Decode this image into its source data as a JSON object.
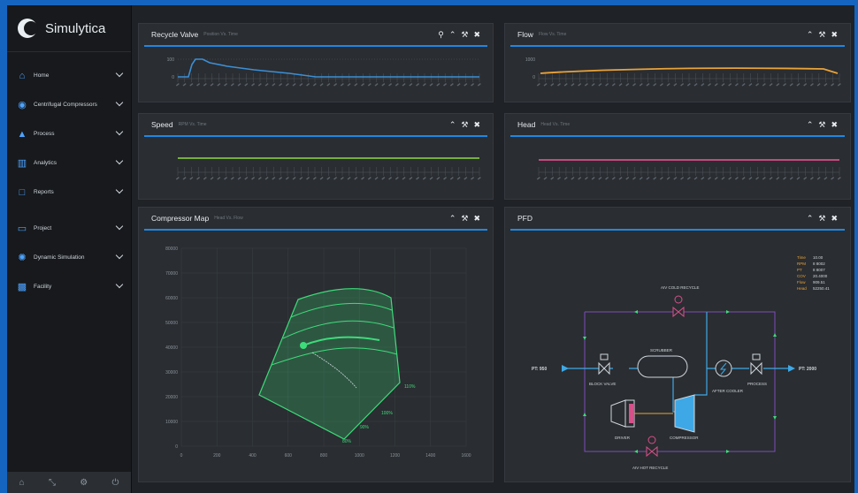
{
  "app": {
    "name": "Simulytica"
  },
  "sidebar": {
    "items": [
      {
        "label": "Home",
        "icon": "home-icon"
      },
      {
        "label": "Centrifugal Compressors",
        "icon": "compressor-icon"
      },
      {
        "label": "Process",
        "icon": "flask-icon"
      },
      {
        "label": "Analytics",
        "icon": "bar-chart-icon"
      },
      {
        "label": "Reports",
        "icon": "report-icon"
      },
      {
        "label": "Project",
        "icon": "folder-icon"
      },
      {
        "label": "Dynamic Simulation",
        "icon": "simulation-icon"
      },
      {
        "label": "Facility",
        "icon": "factory-icon"
      }
    ],
    "footer": [
      "home-icon",
      "expand-icon",
      "settings-icon",
      "power-icon"
    ]
  },
  "panels": {
    "recycle": {
      "title": "Recycle Valve",
      "subtitle": "Position Vs. Time",
      "ytick_hi": "100",
      "ytick_lo": "0",
      "color": "#3b8fd6"
    },
    "flow": {
      "title": "Flow",
      "subtitle": "Flow Vs. Time",
      "ytick_hi": "1000",
      "ytick_lo": "0",
      "color": "#e8a33a"
    },
    "speed": {
      "title": "Speed",
      "subtitle": "RPM Vs. Time",
      "color": "#7fc241"
    },
    "head": {
      "title": "Head",
      "subtitle": "Head Vs. Time",
      "color": "#d94f8a"
    },
    "map": {
      "title": "Compressor Map",
      "subtitle": "Head Vs. Flow"
    },
    "pfd": {
      "title": "PFD"
    }
  },
  "chart_data": {
    "type": "line",
    "title": "Compressor Map",
    "subtitle": "Head Vs. Flow",
    "x_ticks": [
      "0",
      "200",
      "400",
      "600",
      "800",
      "1000",
      "1200",
      "1400",
      "1600"
    ],
    "y_ticks": [
      "80000",
      "70000",
      "60000",
      "50000",
      "40000",
      "30000",
      "20000",
      "10000",
      "0"
    ],
    "xlim": [
      0,
      1600
    ],
    "ylim": [
      0,
      80000
    ],
    "grid": true,
    "speed_labels": [
      "80%",
      "90%",
      "100%",
      "110%"
    ]
  },
  "pfd": {
    "pt_in": "PT: 950",
    "pt_out": "PT: 2000",
    "block_valve": "BLOCK VALVE",
    "scrubber": "SCRUBBER",
    "after_cooler": "AFTER COOLER",
    "process": "PROCESS",
    "driver": "DRIVER",
    "compressor": "COMPRESSOR",
    "cold_recycle": "AIV COLD RECYCLE",
    "hot_recycle": "AIV HOT RECYCLE",
    "readouts": [
      {
        "label": "Time",
        "value": "10.00"
      },
      {
        "label": "RPM",
        "value": "8 8002"
      },
      {
        "label": "PT",
        "value": "8 8007"
      },
      {
        "label": "COV",
        "value": "20.4000"
      },
      {
        "label": "Flow",
        "value": "909.51"
      },
      {
        "label": "Head",
        "value": "52250.41"
      }
    ]
  }
}
